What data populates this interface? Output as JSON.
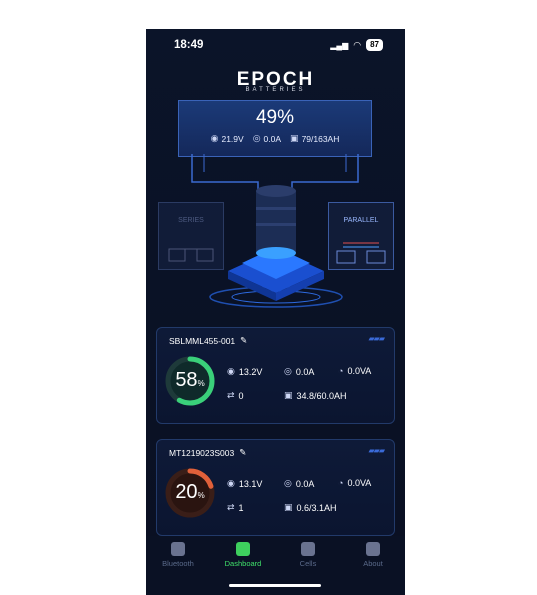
{
  "status_bar": {
    "time": "18:49",
    "battery": "87"
  },
  "brand": {
    "name": "EPOCH",
    "sub": "BATTERIES"
  },
  "summary": {
    "percent": "49%",
    "voltage": "21.9V",
    "current": "0.0A",
    "capacity": "79/163AH"
  },
  "modes": {
    "series": "SERIES",
    "parallel": "PARALLEL"
  },
  "batteries": [
    {
      "name": "SBLMML455-001",
      "percent": "58",
      "percent_fraction": 0.58,
      "ring_color": "#3ad07a",
      "voltage": "13.2V",
      "current": "0.0A",
      "power": "0.0VA",
      "cycles": "0",
      "capacity": "34.8/60.0AH"
    },
    {
      "name": "MT1219023S003",
      "percent": "20",
      "percent_fraction": 0.2,
      "ring_color": "#e0603a",
      "voltage": "13.1V",
      "current": "0.0A",
      "power": "0.0VA",
      "cycles": "1",
      "capacity": "0.6/3.1AH"
    }
  ],
  "nav": [
    {
      "label": "Bluetooth",
      "active": false
    },
    {
      "label": "Dashboard",
      "active": true
    },
    {
      "label": "Cells",
      "active": false
    },
    {
      "label": "About",
      "active": false
    }
  ],
  "pct_unit": "%"
}
